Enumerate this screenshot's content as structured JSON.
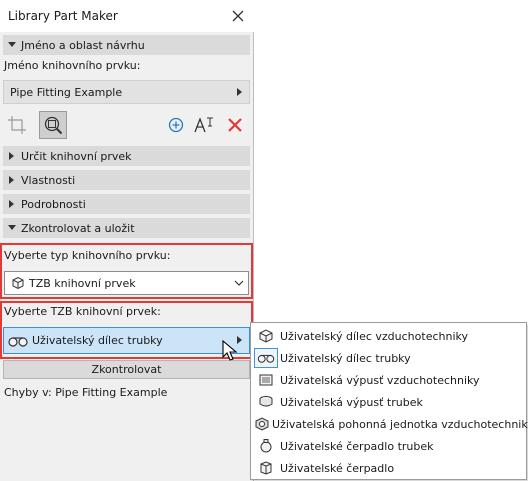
{
  "window": {
    "title": "Library Part Maker",
    "close_icon": "close-icon"
  },
  "sections": {
    "name_area": "Jméno a oblast návrhu",
    "define": "Určit knihovní prvek",
    "properties": "Vlastnosti",
    "details": "Podrobnosti",
    "check_save": "Zkontrolovat a uložit"
  },
  "name_label": "Jméno knihovního prvku:",
  "name_value": "Pipe Fitting Example",
  "toolbar": {
    "icons": [
      "crop-icon",
      "zoom-area-icon",
      "add-icon",
      "text-size-icon",
      "delete-icon"
    ],
    "colors": {
      "add": "#1e78d7",
      "delete": "#e53935"
    }
  },
  "type": {
    "label": "Vyberte typ knihovního prvku:",
    "value": "TZB knihovní prvek"
  },
  "mep": {
    "label": "Vyberte TZB knihovní prvek:",
    "value": "Uživatelský dílec trubky"
  },
  "check_button": "Zkontrolovat",
  "errors_text": "Chyby v: Pipe Fitting Example",
  "popup": {
    "items": [
      "Uživatelský dílec vzduchotechniky",
      "Uživatelský dílec trubky",
      "Uživatelská výpusť vzduchotechniky",
      "Uživatelská výpusť trubek",
      "Uživatelská pohonná jednotka vzduchotechniky",
      "Uživatelské čerpadlo trubek",
      "Uživatelské čerpadlo"
    ],
    "selected_index": 1
  },
  "highlight_color": "#e53935",
  "selection_color": "#cce4f7"
}
